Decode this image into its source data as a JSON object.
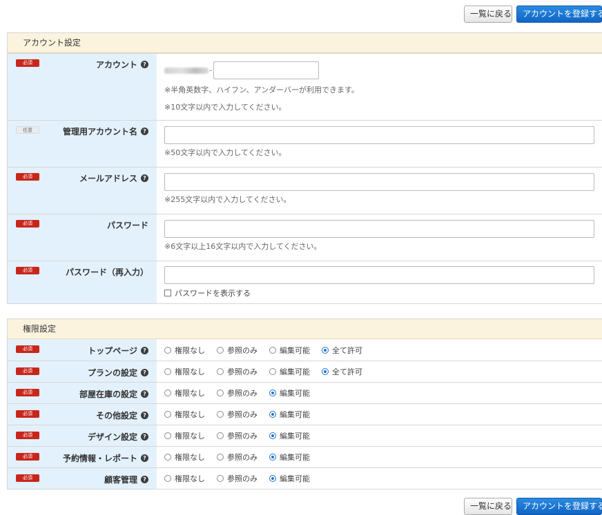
{
  "toolbar": {
    "back_label": "一覧に戻る",
    "register_label": "アカウントを登録する"
  },
  "account_section": {
    "title": "アカウント設定",
    "rows": [
      {
        "badge": "必須",
        "label": "アカウント",
        "prefix_suffix": "-",
        "notes": [
          "※半角英数字、ハイフン、アンダーバーが利用できます。",
          "※10文字以内で入力してください。"
        ]
      },
      {
        "badge": "任意",
        "label": "管理用アカウント名",
        "notes": [
          "※50文字以内で入力してください。"
        ]
      },
      {
        "badge": "必須",
        "label": "メールアドレス",
        "notes": [
          "※255文字以内で入力してください。"
        ]
      },
      {
        "badge": "必須",
        "label": "パスワード",
        "notes": [
          "※6文字以上16文字以内で入力してください。"
        ]
      },
      {
        "badge": "必須",
        "label": "パスワード（再入力）",
        "checkbox_label": "パスワードを表示する"
      }
    ]
  },
  "permission_section": {
    "title": "権限設定",
    "options": [
      "権限なし",
      "参照のみ",
      "編集可能",
      "全て許可"
    ],
    "rows": [
      {
        "badge": "必須",
        "label": "トップページ",
        "selected": "全て許可"
      },
      {
        "badge": "必須",
        "label": "プランの設定",
        "selected": "全て許可"
      },
      {
        "badge": "必須",
        "label": "部屋在庫の設定",
        "selected": "編集可能"
      },
      {
        "badge": "必須",
        "label": "その他設定",
        "selected": "編集可能"
      },
      {
        "badge": "必須",
        "label": "デザイン設定",
        "selected": "編集可能"
      },
      {
        "badge": "必須",
        "label": "予約情報・レポート",
        "selected": "編集可能"
      },
      {
        "badge": "必須",
        "label": "顧客管理",
        "selected": "編集可能"
      }
    ]
  },
  "help_icon": "question-circle-icon",
  "colors": {
    "required_badge": "#c8261b",
    "primary_button": "#1a75d2",
    "label_bg": "#e3f1fc",
    "section_head_bg": "#fbf3de"
  }
}
